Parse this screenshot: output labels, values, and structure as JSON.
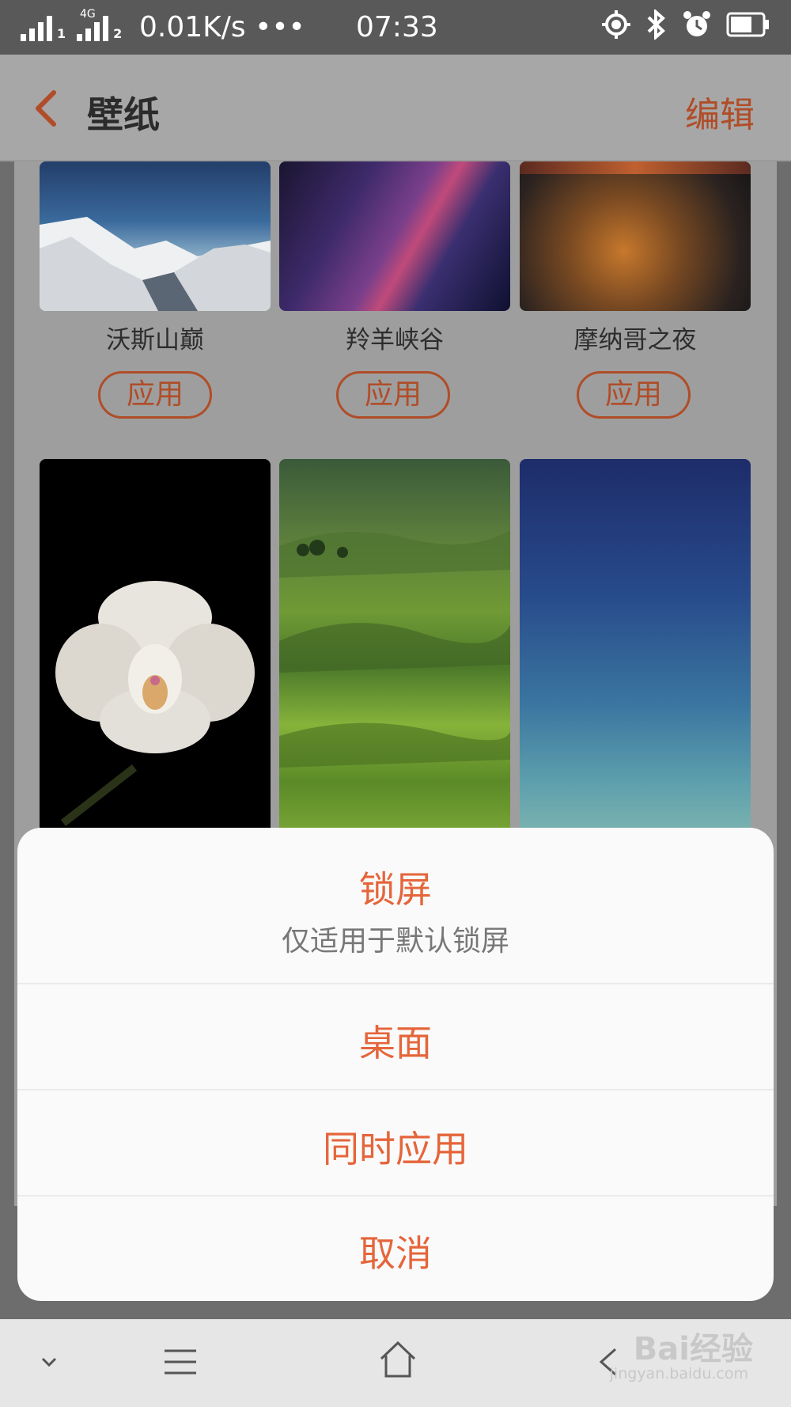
{
  "status_bar": {
    "network_type": "4G",
    "sim1": "1",
    "sim2": "2",
    "speed": "0.01K/s •••",
    "time": "07:33"
  },
  "header": {
    "title": "壁纸",
    "edit_label": "编辑",
    "accent_color": "#b04d28"
  },
  "wallpapers": [
    {
      "name": "沃斯山巅",
      "apply_label": "应用"
    },
    {
      "name": "羚羊峡谷",
      "apply_label": "应用"
    },
    {
      "name": "摩纳哥之夜",
      "apply_label": "应用"
    }
  ],
  "sheet": {
    "options": [
      {
        "label": "锁屏",
        "subtitle": "仅适用于默认锁屏"
      },
      {
        "label": "桌面"
      },
      {
        "label": "同时应用"
      },
      {
        "label": "取消"
      }
    ],
    "option_color": "#e5653b"
  },
  "nav_bar": {
    "icons": [
      "chevron-down-icon",
      "menu-icon",
      "home-icon",
      "back-icon"
    ]
  },
  "watermark": {
    "brand": "Bai经验",
    "url": "jingyan.baidu.com"
  }
}
